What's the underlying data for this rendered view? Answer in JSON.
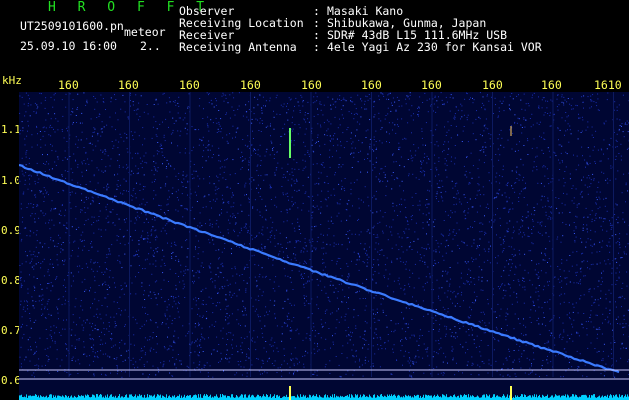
{
  "header": {
    "program": "H R O F F T",
    "filename": "UT2509101600.pn",
    "mode": "meteor",
    "datetime": "25.09.10 16:00",
    "page": "2..",
    "fields": [
      {
        "label": "Observer",
        "sep": ":",
        "value": "Masaki Kano"
      },
      {
        "label": "Receiving Location",
        "sep": ":",
        "value": "Shibukawa, Gunma, Japan"
      },
      {
        "label": "Receiver",
        "sep": ":",
        "value": "SDR# 43dB L15 111.6MHz USB"
      },
      {
        "label": "Receiving Antenna",
        "sep": ":",
        "value": "4ele Yagi Az 230 for Kansai VOR"
      }
    ]
  },
  "spectrogram": {
    "x_ticks": [
      "160",
      "160",
      "160",
      "160",
      "160",
      "160",
      "160",
      "160",
      "160",
      "1610"
    ],
    "y_unit": "kHz",
    "y_ticks": [
      "1.1",
      "1.0",
      "0.9",
      "0.8",
      "0.7",
      "0.6"
    ],
    "trace_khz_start": 1.03,
    "trace_khz_end": 0.615,
    "colors": {
      "background": "#000633",
      "trace": "#3b7bff",
      "meteor": "#66ff66",
      "axis": "#ffff55",
      "baseline": "#00d0ff"
    }
  }
}
